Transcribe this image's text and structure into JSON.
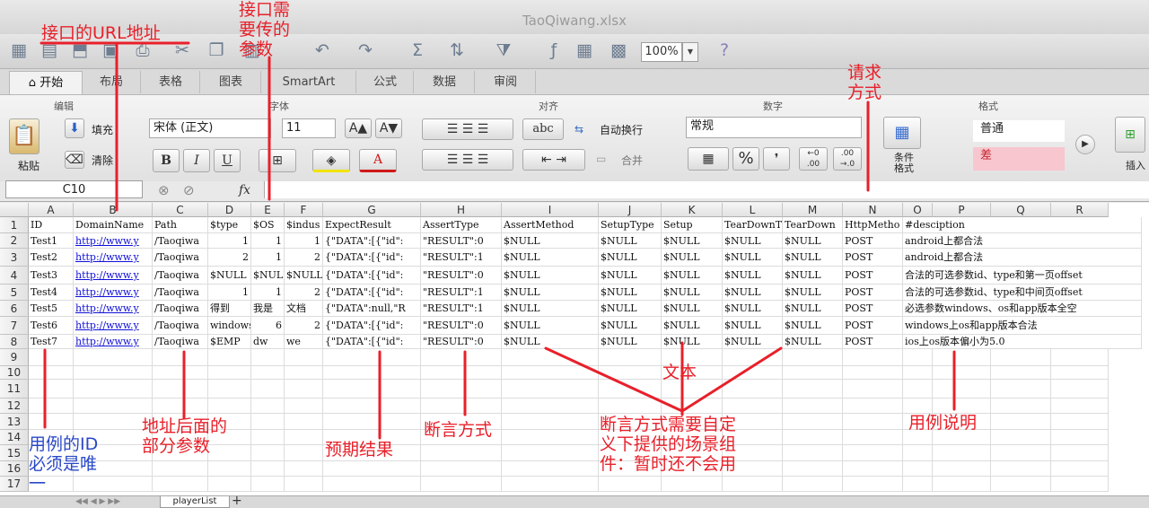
{
  "window": {
    "title": "TaoQiwang.xlsx"
  },
  "toolbar": {
    "zoom": "100%"
  },
  "tabs": [
    "开始",
    "布局",
    "表格",
    "图表",
    "SmartArt",
    "公式",
    "数据",
    "审阅"
  ],
  "ribbon": {
    "groups": {
      "edit": "编辑",
      "font": "字体",
      "align": "对齐",
      "number": "数字",
      "format": "格式"
    },
    "paste": "粘贴",
    "fill": "填充",
    "clear": "清除",
    "font_name": "宋体 (正文)",
    "font_size": "11",
    "bold": "B",
    "italic": "I",
    "underline": "U",
    "font_color_glyph": "A",
    "wrap_text": "自动换行",
    "merge": "合并",
    "abc": "abc",
    "number_format": "常规",
    "percent": "%",
    "comma": "❜",
    "dec_inc": "←0\n.00",
    "dec_dec": ".00\n→.0",
    "cond_format": "条件\n格式",
    "style_normal": "普通",
    "style_bad": "差",
    "insert": "插入"
  },
  "formula_bar": {
    "cell_ref": "C10",
    "fx": "fx",
    "value": ""
  },
  "sheet": {
    "columns": [
      "A",
      "B",
      "C",
      "D",
      "E",
      "F",
      "G",
      "H",
      "I",
      "J",
      "K",
      "L",
      "M",
      "N",
      "O",
      "P",
      "Q",
      "R"
    ],
    "row_numbers": [
      "1",
      "2",
      "3",
      "4",
      "5",
      "6",
      "7",
      "8",
      "9",
      "10",
      "11",
      "12",
      "13",
      "14",
      "15",
      "16",
      "17"
    ],
    "rows": [
      [
        "ID",
        "DomainName",
        "Path",
        "$type",
        "$OS",
        "$indus",
        "ExpectResult",
        "AssertType",
        "AssertMethod",
        "SetupType",
        "Setup",
        "TearDownT",
        "TearDown",
        "HttpMetho",
        "#desciption"
      ],
      [
        "Test1",
        "http://www.y",
        "/Taoqiwa",
        "1",
        "1",
        "1",
        "{\"DATA\":[{\"id\":",
        "\"RESULT\":0",
        "$NULL",
        "$NULL",
        "$NULL",
        "$NULL",
        "$NULL",
        "POST",
        "android上都合法"
      ],
      [
        "Test2",
        "http://www.y",
        "/Taoqiwa",
        "2",
        "1",
        "2",
        "{\"DATA\":[{\"id\":",
        "\"RESULT\":1",
        "$NULL",
        "$NULL",
        "$NULL",
        "$NULL",
        "$NULL",
        "POST",
        "android上都合法"
      ],
      [
        "Test3",
        "http://www.y",
        "/Taoqiwa",
        "$NULL",
        "$NULL",
        "$NULL",
        "{\"DATA\":[{\"id\":",
        "\"RESULT\":0",
        "$NULL",
        "$NULL",
        "$NULL",
        "$NULL",
        "$NULL",
        "POST",
        "合法的可选参数id、type和第一页offset"
      ],
      [
        "Test4",
        "http://www.y",
        "/Taoqiwa",
        "1",
        "1",
        "2",
        "{\"DATA\":[{\"id\":",
        "\"RESULT\":1",
        "$NULL",
        "$NULL",
        "$NULL",
        "$NULL",
        "$NULL",
        "POST",
        "合法的可选参数id、type和中间页offset"
      ],
      [
        "Test5",
        "http://www.y",
        "/Taoqiwa",
        "得到",
        "我是",
        "文档",
        "{\"DATA\":null,\"R",
        "\"RESULT\":1",
        "$NULL",
        "$NULL",
        "$NULL",
        "$NULL",
        "$NULL",
        "POST",
        "必选参数windows、os和app版本全空"
      ],
      [
        "Test6",
        "http://www.y",
        "/Taoqiwa",
        "windows",
        "6",
        "2",
        "{\"DATA\":[{\"id\":",
        "\"RESULT\":0",
        "$NULL",
        "$NULL",
        "$NULL",
        "$NULL",
        "$NULL",
        "POST",
        "windows上os和app版本合法"
      ],
      [
        "Test7",
        "http://www.y",
        "/Taoqiwa",
        "$EMP",
        "dw",
        "we",
        "{\"DATA\":[{\"id\":",
        "\"RESULT\":0",
        "$NULL",
        "$NULL",
        "$NULL",
        "$NULL",
        "$NULL",
        "POST",
        "ios上os版本偏小为5.0"
      ]
    ],
    "sheet_tab": "playerList",
    "add_sheet": "+"
  },
  "annotations": [
    "接口的URL地址",
    "接口需\n要传的\n参数",
    "请求\n方式",
    "用例的ID\n必须是唯\n一",
    "地址后面的\n部分参数",
    "预期结果",
    "断言方式",
    "文本",
    "断言方式需要自定\n义下提供的场景组\n件：暂时还不会用",
    "用例说明"
  ],
  "colors": {
    "annotation": "#e8202a",
    "link": "#0f0fd8",
    "style_bad_bg": "#f7c6ce"
  }
}
